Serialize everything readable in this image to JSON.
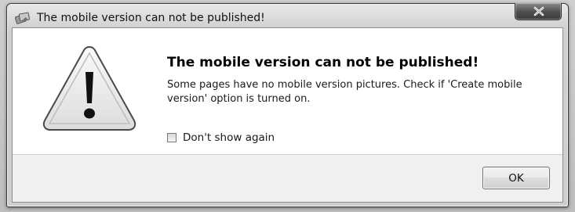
{
  "window": {
    "title": "The mobile version can not be published!",
    "close_icon": "close-icon",
    "app_icon": "app-icon"
  },
  "dialog": {
    "icon": "warning-icon",
    "heading": "The mobile version can not be published!",
    "message": "Some pages have no mobile version pictures. Check if 'Create mobile version' option is turned on.",
    "checkbox": {
      "label": "Don't show again",
      "checked": false
    },
    "ok_label": "OK"
  },
  "colors": {
    "warning_triangle_fill": "#eeeeee",
    "warning_mark": "#111111",
    "close_button": "#4e4e4e"
  }
}
